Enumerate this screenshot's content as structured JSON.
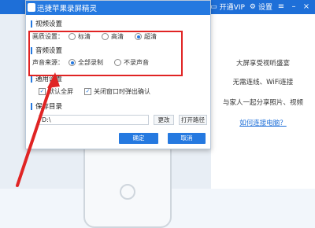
{
  "app": {
    "vip_label": "开通VIP",
    "settings_label": "设置"
  },
  "promo": {
    "line1": "大屏享受视听盛宴",
    "line2": "无需连线、WiFi连接",
    "line3": "与家人一起分享照片、视频",
    "link": "如何连接电脑？"
  },
  "dialog": {
    "title": "迅捷苹果录屏精灵",
    "video": {
      "section": "视频设置",
      "label": "画质设置：",
      "options": [
        "标清",
        "高清",
        "超清"
      ],
      "selected_index": 2
    },
    "audio": {
      "section": "音频设置",
      "label": "声音来源：",
      "options": [
        "全部录制",
        "不录声音"
      ],
      "selected_index": 0
    },
    "general": {
      "section": "通用设置",
      "check1": "默认全屏",
      "check2": "关闭窗口时弹出确认"
    },
    "save": {
      "section": "保存目录",
      "path": "D:\\",
      "change_btn": "更改",
      "open_btn": "打开路径"
    },
    "confirm_btn": "确定",
    "cancel_btn": "取消"
  },
  "colors": {
    "accent": "#2579e0",
    "annotation": "#e02424"
  }
}
